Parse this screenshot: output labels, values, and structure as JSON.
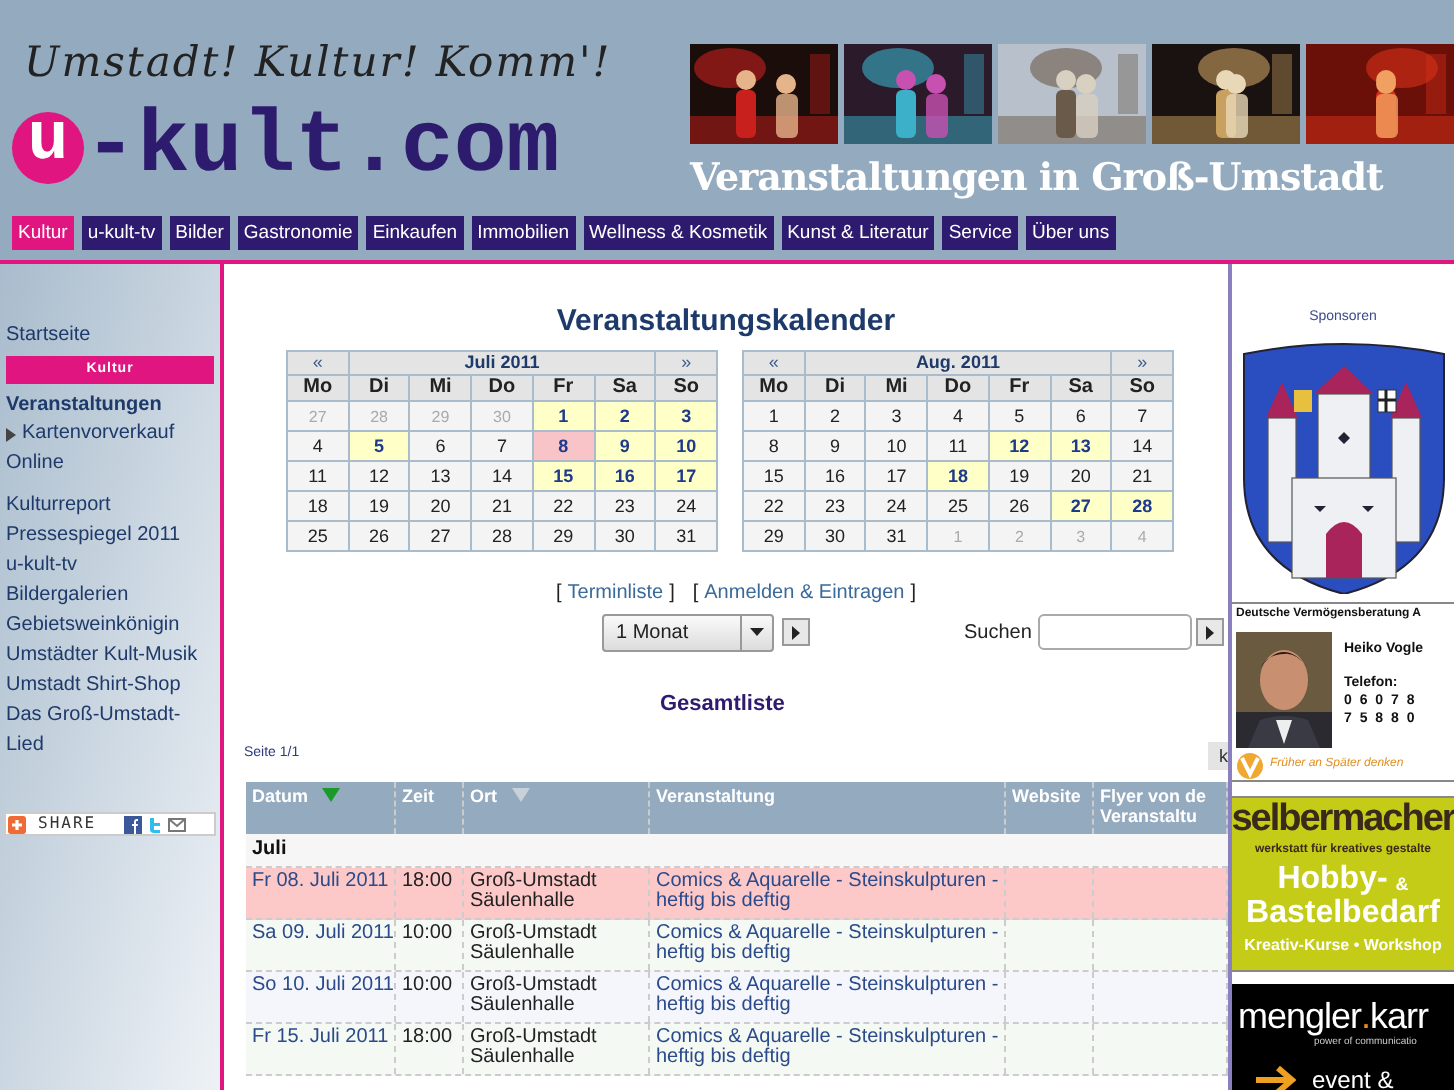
{
  "header": {
    "slogan": "Umstadt! Kultur! Komm'!",
    "logo": {
      "mark": "u",
      "text": "-kult.com"
    },
    "title": "Veranstaltungen in Groß-Umstadt"
  },
  "nav": [
    {
      "label": "Kultur",
      "selected": true
    },
    {
      "label": "u-kult-tv",
      "selected": false
    },
    {
      "label": "Bilder",
      "selected": false
    },
    {
      "label": "Gastronomie",
      "selected": false
    },
    {
      "label": "Einkaufen",
      "selected": false
    },
    {
      "label": "Immobilien",
      "selected": false
    },
    {
      "label": "Wellness & Kosmetik",
      "selected": false
    },
    {
      "label": "Kunst & Literatur",
      "selected": false
    },
    {
      "label": "Service",
      "selected": false
    },
    {
      "label": "Über uns",
      "selected": false
    }
  ],
  "sidebar": {
    "groups": [
      [
        {
          "label": "Startseite",
          "kind": "link"
        },
        {
          "label": "Kultur",
          "kind": "section"
        },
        {
          "label": "Veranstaltungen",
          "kind": "current"
        },
        {
          "label": "Kartenvorverkauf",
          "kind": "sub"
        },
        {
          "label": "Online",
          "kind": "link"
        }
      ],
      [
        {
          "label": "Kulturreport",
          "kind": "link"
        },
        {
          "label": "Pressespiegel 2011",
          "kind": "link"
        },
        {
          "label": "u-kult-tv",
          "kind": "link"
        },
        {
          "label": "Bildergalerien",
          "kind": "link"
        },
        {
          "label": "Gebietsweinkönigin",
          "kind": "link"
        },
        {
          "label": "Umstädter Kult-Musik",
          "kind": "link"
        },
        {
          "label": "Umstadt Shirt-Shop",
          "kind": "link"
        },
        {
          "label": "Das Groß-Umstadt-Lied",
          "kind": "link"
        }
      ]
    ],
    "share": {
      "label": "SHARE"
    }
  },
  "main": {
    "title": "Veranstaltungskalender",
    "calendars": [
      {
        "prev": "«",
        "month": "Juli 2011",
        "next": "»",
        "weekdays": [
          "Mo",
          "Di",
          "Mi",
          "Do",
          "Fr",
          "Sa",
          "So"
        ],
        "weeks": [
          [
            {
              "d": "27",
              "kind": "other"
            },
            {
              "d": "28",
              "kind": "other"
            },
            {
              "d": "29",
              "kind": "other"
            },
            {
              "d": "30",
              "kind": "other"
            },
            {
              "d": "1",
              "kind": "event"
            },
            {
              "d": "2",
              "kind": "event"
            },
            {
              "d": "3",
              "kind": "event"
            }
          ],
          [
            {
              "d": "4",
              "kind": "plain"
            },
            {
              "d": "5",
              "kind": "event"
            },
            {
              "d": "6",
              "kind": "plain"
            },
            {
              "d": "7",
              "kind": "plain"
            },
            {
              "d": "8",
              "kind": "today"
            },
            {
              "d": "9",
              "kind": "event"
            },
            {
              "d": "10",
              "kind": "event"
            }
          ],
          [
            {
              "d": "11",
              "kind": "plain"
            },
            {
              "d": "12",
              "kind": "plain"
            },
            {
              "d": "13",
              "kind": "plain"
            },
            {
              "d": "14",
              "kind": "plain"
            },
            {
              "d": "15",
              "kind": "event"
            },
            {
              "d": "16",
              "kind": "event"
            },
            {
              "d": "17",
              "kind": "event"
            }
          ],
          [
            {
              "d": "18",
              "kind": "plain"
            },
            {
              "d": "19",
              "kind": "plain"
            },
            {
              "d": "20",
              "kind": "plain"
            },
            {
              "d": "21",
              "kind": "plain"
            },
            {
              "d": "22",
              "kind": "plain"
            },
            {
              "d": "23",
              "kind": "plain"
            },
            {
              "d": "24",
              "kind": "plain"
            }
          ],
          [
            {
              "d": "25",
              "kind": "plain"
            },
            {
              "d": "26",
              "kind": "plain"
            },
            {
              "d": "27",
              "kind": "plain"
            },
            {
              "d": "28",
              "kind": "plain"
            },
            {
              "d": "29",
              "kind": "plain"
            },
            {
              "d": "30",
              "kind": "plain"
            },
            {
              "d": "31",
              "kind": "plain"
            }
          ]
        ]
      },
      {
        "prev": "«",
        "month": "Aug. 2011",
        "next": "»",
        "weekdays": [
          "Mo",
          "Di",
          "Mi",
          "Do",
          "Fr",
          "Sa",
          "So"
        ],
        "weeks": [
          [
            {
              "d": "1",
              "kind": "plain"
            },
            {
              "d": "2",
              "kind": "plain"
            },
            {
              "d": "3",
              "kind": "plain"
            },
            {
              "d": "4",
              "kind": "plain"
            },
            {
              "d": "5",
              "kind": "plain"
            },
            {
              "d": "6",
              "kind": "plain"
            },
            {
              "d": "7",
              "kind": "plain"
            }
          ],
          [
            {
              "d": "8",
              "kind": "plain"
            },
            {
              "d": "9",
              "kind": "plain"
            },
            {
              "d": "10",
              "kind": "plain"
            },
            {
              "d": "11",
              "kind": "plain"
            },
            {
              "d": "12",
              "kind": "event"
            },
            {
              "d": "13",
              "kind": "event"
            },
            {
              "d": "14",
              "kind": "plain"
            }
          ],
          [
            {
              "d": "15",
              "kind": "plain"
            },
            {
              "d": "16",
              "kind": "plain"
            },
            {
              "d": "17",
              "kind": "plain"
            },
            {
              "d": "18",
              "kind": "event"
            },
            {
              "d": "19",
              "kind": "plain"
            },
            {
              "d": "20",
              "kind": "plain"
            },
            {
              "d": "21",
              "kind": "plain"
            }
          ],
          [
            {
              "d": "22",
              "kind": "plain"
            },
            {
              "d": "23",
              "kind": "plain"
            },
            {
              "d": "24",
              "kind": "plain"
            },
            {
              "d": "25",
              "kind": "plain"
            },
            {
              "d": "26",
              "kind": "plain"
            },
            {
              "d": "27",
              "kind": "event"
            },
            {
              "d": "28",
              "kind": "event"
            }
          ],
          [
            {
              "d": "29",
              "kind": "plain"
            },
            {
              "d": "30",
              "kind": "plain"
            },
            {
              "d": "31",
              "kind": "plain"
            },
            {
              "d": "1",
              "kind": "other"
            },
            {
              "d": "2",
              "kind": "other"
            },
            {
              "d": "3",
              "kind": "other"
            },
            {
              "d": "4",
              "kind": "other"
            }
          ]
        ]
      }
    ],
    "links": [
      {
        "before": "[",
        "label": "Terminliste",
        "after": "]"
      },
      {
        "before": "[",
        "label": "Anmelden & Eintragen",
        "after": "]"
      }
    ],
    "period_select": {
      "value": "1 Monat"
    },
    "search": {
      "label": "Suchen"
    },
    "list_title": "Gesamtliste",
    "page_info": "Seite 1/1",
    "pager_button": "k",
    "table": {
      "columns": [
        {
          "label": "Datum",
          "sorted": true
        },
        {
          "label": "Zeit"
        },
        {
          "label": "Ort",
          "sorted": false
        },
        {
          "label": "Veranstaltung"
        },
        {
          "label": "Website"
        },
        {
          "label": "Flyer von de",
          "label_2": "Veranstaltu"
        }
      ],
      "group": "Juli",
      "rows": [
        {
          "date": "Fr 08. Juli 2011",
          "time": "18:00",
          "place": "Groß-Umstadt",
          "venue": "Säulenhalle",
          "event": "Comics & Aquarelle - Steinskulpturen - heftig bis deftig",
          "selected": true
        },
        {
          "date": "Sa 09. Juli 2011",
          "time": "10:00",
          "place": "Groß-Umstadt",
          "venue": "Säulenhalle",
          "event": "Comics & Aquarelle - Steinskulpturen - heftig bis deftig",
          "selected": false
        },
        {
          "date": "So 10. Juli 2011",
          "time": "10:00",
          "place": "Groß-Umstadt",
          "venue": "Säulenhalle",
          "event": "Comics & Aquarelle - Steinskulpturen - heftig bis deftig",
          "selected": false
        },
        {
          "date": "Fr 15. Juli 2011",
          "time": "18:00",
          "place": "Groß-Umstadt",
          "venue": "Säulenhalle",
          "event": "Comics & Aquarelle - Steinskulpturen - heftig bis deftig",
          "selected": false
        }
      ]
    }
  },
  "sponsors": {
    "title": "Sponsoren",
    "ad_dvag": {
      "company": "Deutsche Vermögensberatung A",
      "name": "Heiko Vogle",
      "phone_label": "Telefon:",
      "phone_1": "0 6 0 7 8",
      "phone_2": "7 5 8 8 0",
      "motto": "Früher an Später denken"
    },
    "ad_hobby": {
      "brand": "selbermacher",
      "tagline": "werkstatt für kreatives gestalte",
      "line_1": "Hobby-",
      "amp": "&",
      "line_2": "Bastelbedarf",
      "footer": "Kreativ-Kurse • Workshop"
    },
    "ad_mengler": {
      "brand_1": "mengler",
      "dot": ".",
      "brand_2": "karr",
      "tagline": "power of communicatio",
      "text": "event &"
    }
  }
}
